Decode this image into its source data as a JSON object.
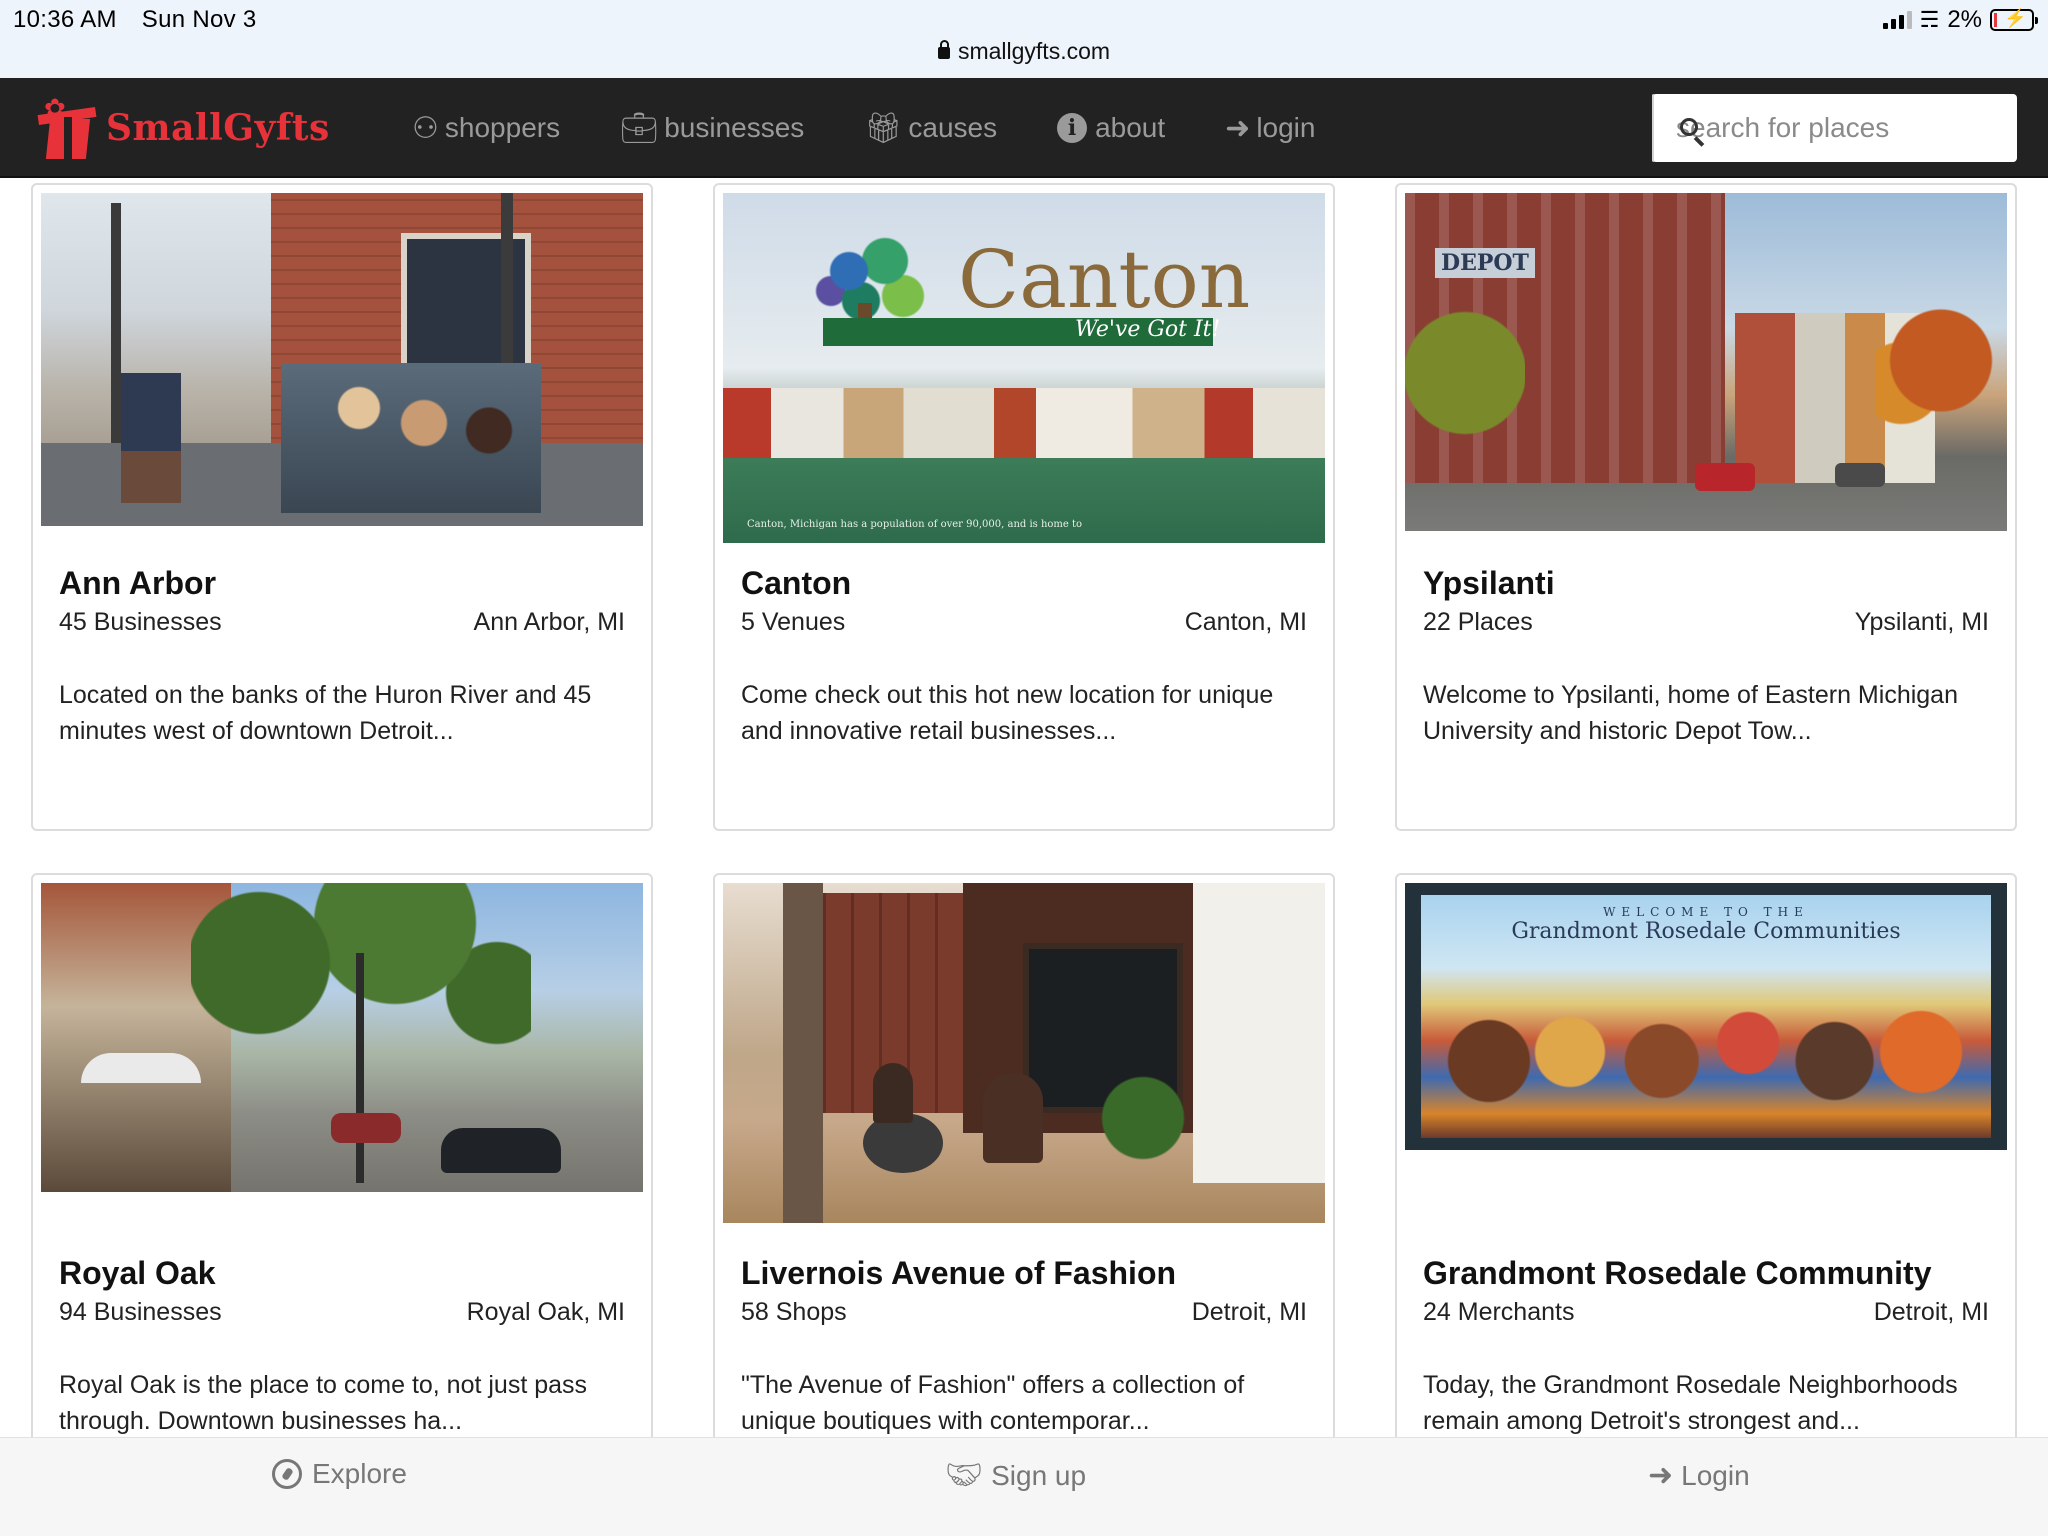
{
  "status": {
    "time": "10:36 AM",
    "date": "Sun Nov 3",
    "battery": "2%",
    "url": "smallgyfts.com"
  },
  "nav": {
    "brand": "SmallGyfts",
    "links": [
      {
        "label": "shoppers",
        "icon": "users-icon"
      },
      {
        "label": "businesses",
        "icon": "briefcase-icon"
      },
      {
        "label": "causes",
        "icon": "gift-icon"
      },
      {
        "label": "about",
        "icon": "info-icon"
      },
      {
        "label": "login",
        "icon": "sign-in-icon"
      }
    ],
    "search_placeholder": "search for places"
  },
  "cards": [
    {
      "title": "Ann Arbor",
      "count": "45 Businesses",
      "location": "Ann Arbor, MI",
      "description": "Located on the banks of the Huron River and 45 minutes west of downtown Detroit...",
      "image_text": ""
    },
    {
      "title": "Canton",
      "count": "5 Venues",
      "location": "Canton, MI",
      "description": "Come check out this hot new location for unique and innovative retail businesses...",
      "image_text": "Canton",
      "image_tagline": "We've Got It!",
      "image_caption": "Canton, Michigan has a population of over 90,000, and is home to"
    },
    {
      "title": "Ypsilanti",
      "count": "22 Places",
      "location": "Ypsilanti, MI",
      "description": "Welcome to Ypsilanti, home of Eastern Michigan University and historic Depot Tow...",
      "image_text": "DEPOT"
    },
    {
      "title": "Royal Oak",
      "count": "94 Businesses",
      "location": "Royal Oak, MI",
      "description": "Royal Oak is the place to come to, not just pass through. Downtown businesses ha...",
      "image_text": ""
    },
    {
      "title": "Livernois Avenue of Fashion",
      "count": "58 Shops",
      "location": "Detroit, MI",
      "description": "\"The Avenue of Fashion\" offers a collection of unique boutiques with contemporar...",
      "image_text": ""
    },
    {
      "title": "Grandmont Rosedale Community",
      "count": "24 Merchants",
      "location": "Detroit, MI",
      "description": "Today, the Grandmont Rosedale Neighborhoods remain among Detroit's strongest and...",
      "image_text": "WELCOME TO THE",
      "image_subtext": "Grandmont Rosedale Communities"
    }
  ],
  "tabbar": [
    {
      "label": "Explore",
      "icon": "compass-icon"
    },
    {
      "label": "Sign up",
      "icon": "handshake-icon"
    },
    {
      "label": "Login",
      "icon": "sign-in-icon"
    }
  ]
}
